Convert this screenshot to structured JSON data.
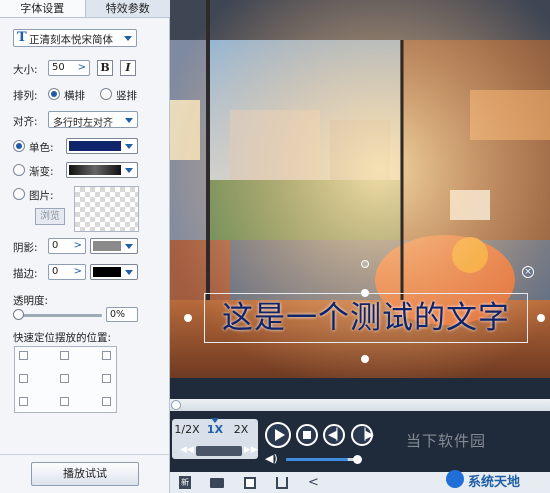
{
  "tabs": {
    "font_settings": "字体设置",
    "effects": "特效参数"
  },
  "font": {
    "name": "正清刻本悦宋简体",
    "icon": "font-T-icon"
  },
  "size": {
    "label": "大小:",
    "value": "50",
    "bold": "B",
    "italic": "I"
  },
  "layout": {
    "label": "排列:",
    "horizontal": "横排",
    "vertical": "竖排",
    "selected": "horizontal"
  },
  "align": {
    "label": "对齐:",
    "value": "多行时左对齐"
  },
  "color": {
    "solid_label": "单色:",
    "solid_color": "#0f246b",
    "gradient_label": "渐变:",
    "image_label": "图片:",
    "browse": "浏览",
    "selected": "solid"
  },
  "shadow": {
    "label": "阴影:",
    "value": "0",
    "color": "#8a8a8a"
  },
  "stroke": {
    "label": "描边:",
    "value": "0",
    "color": "#000000"
  },
  "opacity": {
    "label": "透明度:",
    "value": "0%",
    "level": 0
  },
  "position": {
    "label": "快速定位摆放的位置:"
  },
  "preview_button": "播放试试",
  "preview": {
    "caption": "这是一个测试的文字",
    "caption_color": "#0f246b"
  },
  "speed": {
    "half": "1/2X",
    "one": "1X",
    "two": "2X",
    "selected": "1X"
  },
  "volume_level": 0.82,
  "progress": 0.01,
  "bottom_icons": [
    "new-icon",
    "folder-icon",
    "save-icon",
    "export-icon",
    "share-icon"
  ],
  "watermarks": {
    "downloads": "当下软件园",
    "brand": "系统天地"
  }
}
